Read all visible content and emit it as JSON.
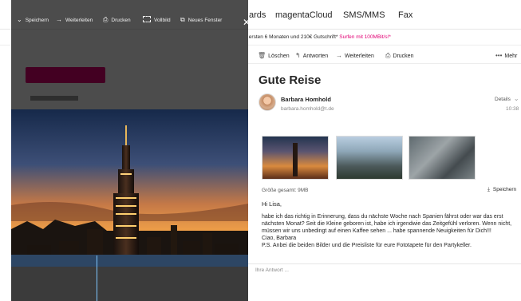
{
  "topnav": {
    "items": [
      "ards",
      "magentaCloud",
      "SMS/MMS",
      "Fax"
    ]
  },
  "promo": {
    "text": "5€ mtl. i.d. ersten 6 Monaten und 210€ Gutschrift*",
    "highlight": "Surfen mit 100MBit/s!*"
  },
  "mail_toolbar": {
    "delete": "Löschen",
    "reply": "Antworten",
    "forward": "Weiterleiten",
    "print": "Drucken",
    "more": "Mehr"
  },
  "message": {
    "subject": "Gute Reise",
    "sender_name": "Barbara Homhold",
    "sender_email": "barbara.homhold@t.de",
    "details_label": "Details",
    "time": "10:38",
    "attachments_size": "Größe gesamt: 9MB",
    "save_label": "Speichern",
    "greeting": "Hi Lisa,",
    "body": "habe ich das richtig in Erinnerung, dass du nächste Woche nach Spanien fährst oder war das erst nächsten Monat? Seit die Kleine geboren ist, habe ich irgendwie das Zeitgefühl verloren. Wenn nicht, müssen wir uns unbedingt auf einen Kaffee sehen ... habe spannende Neuigkeiten für Dich!!!\nCiao, Barbara\nP.S. Anbei die beiden Bilder und die Preisliste für eure Fototapete für den Partykeller.",
    "reply_placeholder": "Ihre Antwort ..."
  },
  "viewer": {
    "save": "Speichern",
    "forward": "Weiterleiten",
    "print": "Drucken",
    "fullscreen": "Vollbild",
    "new_window": "Neues Fenster"
  },
  "colors": {
    "brand": "#e20074",
    "overlay": "#000000"
  }
}
